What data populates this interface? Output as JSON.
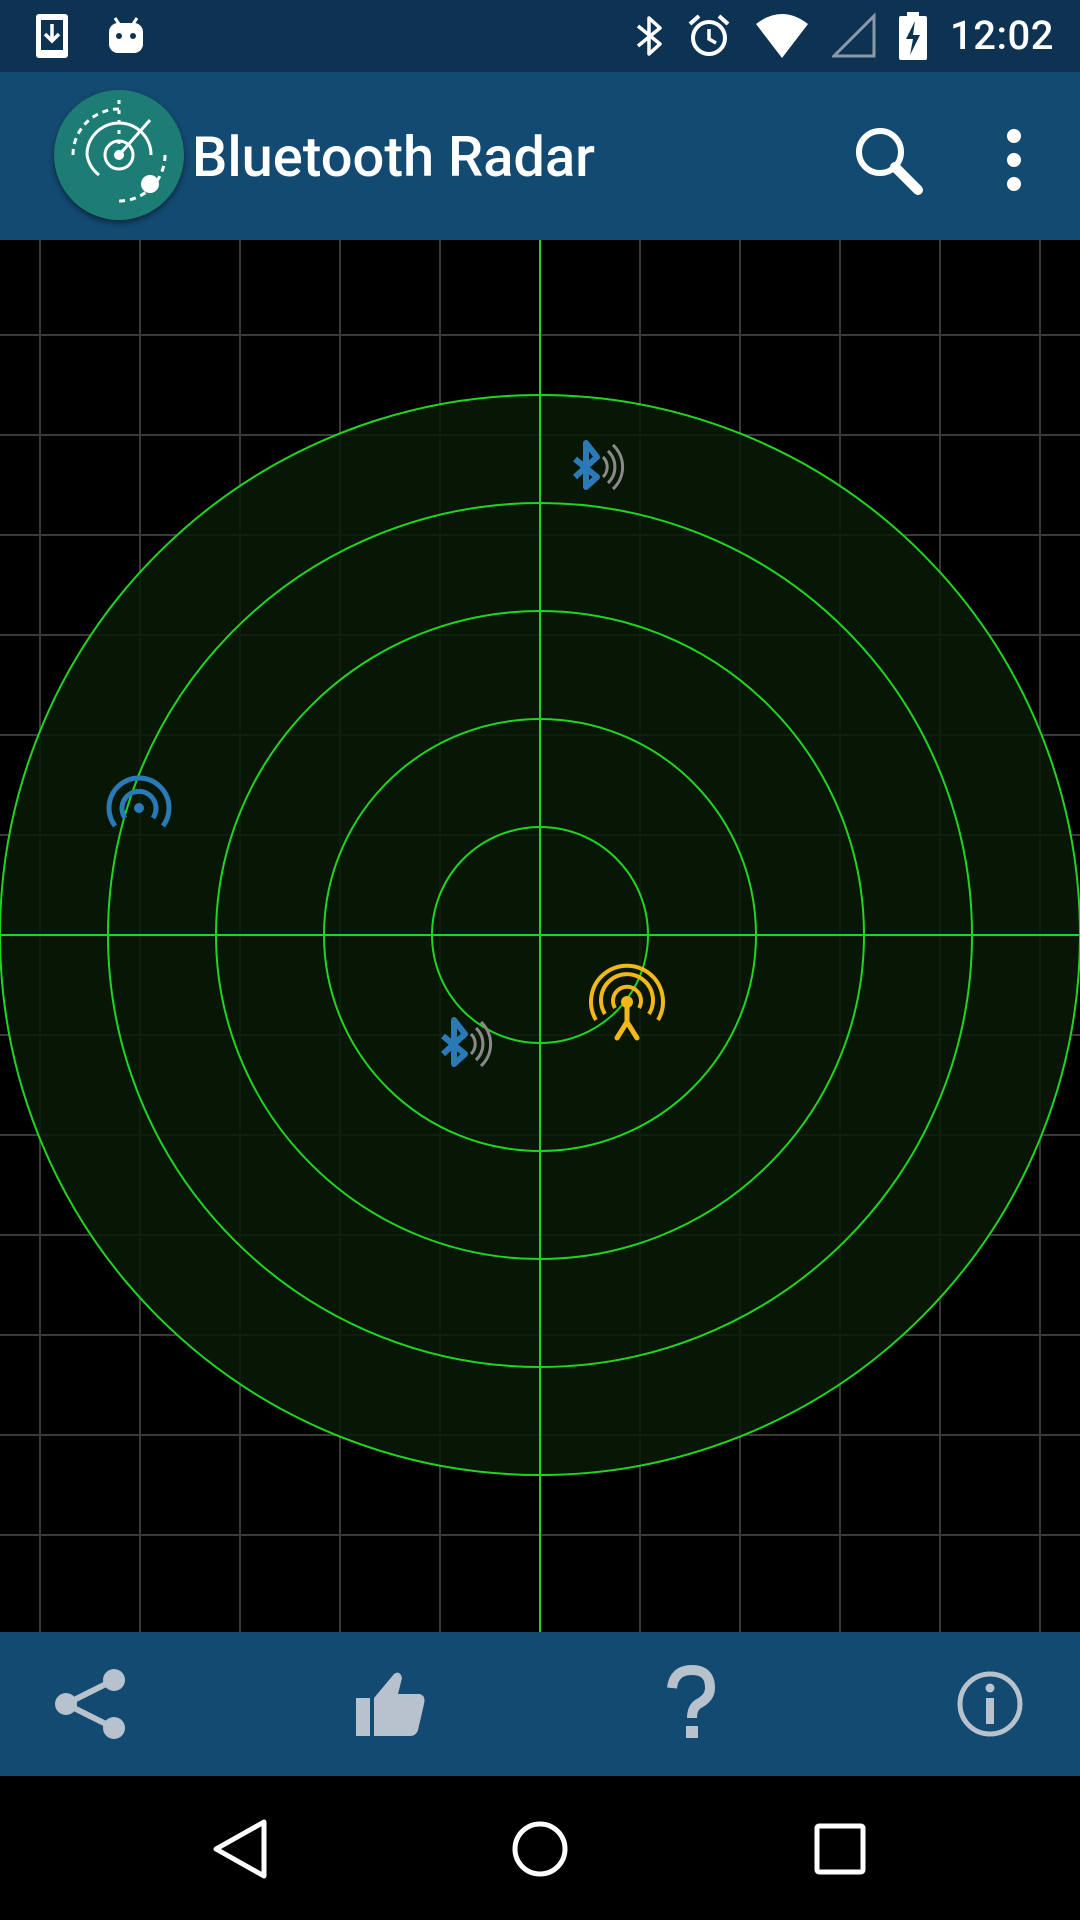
{
  "status_bar": {
    "time": "12:02",
    "left_icons": [
      "download-icon",
      "android-icon"
    ],
    "right_icons": [
      "bluetooth-icon",
      "alarm-icon",
      "wifi-icon",
      "cell-signal-icon",
      "battery-charging-icon"
    ]
  },
  "app_bar": {
    "title": "Bluetooth Radar",
    "actions": [
      "search-icon",
      "overflow-menu-icon"
    ]
  },
  "radar": {
    "colors": {
      "ring": "#22d422",
      "grid": "#3a3a3a",
      "fill": "#081a06"
    },
    "devices": [
      {
        "type": "bluetooth",
        "icon": "bluetooth-signal-icon",
        "color": "#2a7ab8"
      },
      {
        "type": "beacon",
        "icon": "wireless-beacon-icon",
        "color": "#2a7ab8"
      },
      {
        "type": "bluetooth",
        "icon": "bluetooth-signal-icon",
        "color": "#2a7ab8"
      },
      {
        "type": "antenna",
        "icon": "antenna-tower-icon",
        "color": "#f2b81a"
      }
    ]
  },
  "fab": {
    "icon": "scan-refresh-icon"
  },
  "bottom_bar": {
    "items": [
      "share-icon",
      "thumbs-up-icon",
      "help-icon",
      "info-icon"
    ]
  },
  "nav_bar": {
    "items": [
      "back-icon",
      "home-icon",
      "recents-icon"
    ]
  }
}
